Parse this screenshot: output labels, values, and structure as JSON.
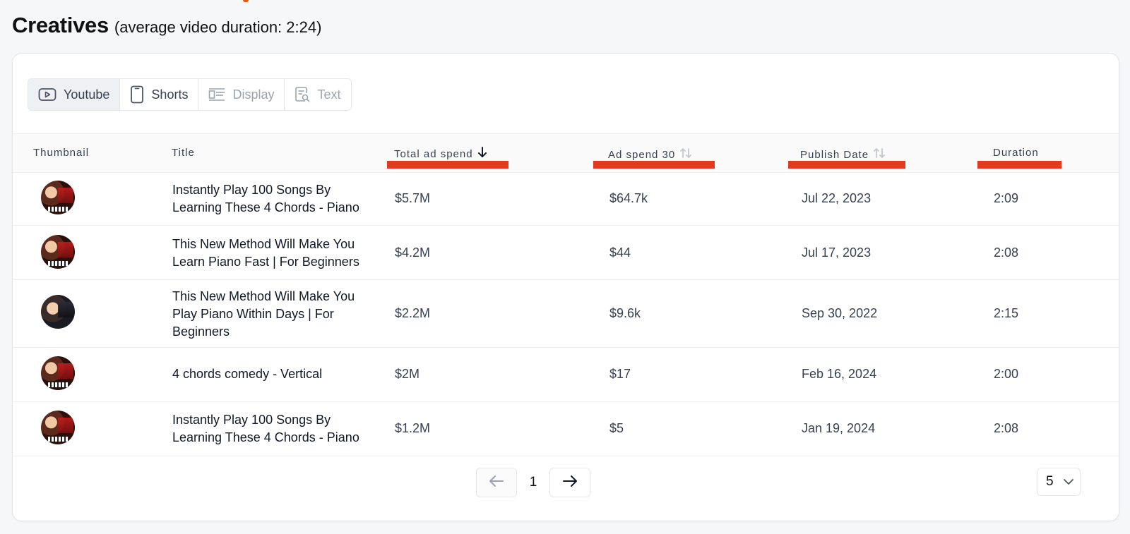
{
  "header": {
    "title": "Creatives",
    "subtitle": "(average video duration: 2:24)"
  },
  "tabs": [
    {
      "label": "Youtube",
      "icon": "youtube-icon",
      "state": "active"
    },
    {
      "label": "Shorts",
      "icon": "shorts-icon",
      "state": "normal"
    },
    {
      "label": "Display",
      "icon": "display-icon",
      "state": "disabled"
    },
    {
      "label": "Text",
      "icon": "text-ad-icon",
      "state": "disabled"
    }
  ],
  "columns": {
    "thumbnail": "Thumbnail",
    "title": "Title",
    "total_ad_spend": "Total ad spend",
    "ad_spend_30": "Ad spend 30",
    "publish_date": "Publish Date",
    "duration": "Duration"
  },
  "highlight_color": "#e5391f",
  "rows": [
    {
      "title_line1": "Instantly Play 100 Songs By",
      "title_line2": "Learning These 4 Chords - Piano",
      "title_line3": "",
      "total": "$5.7M",
      "spend30": "$64.7k",
      "date": "Jul 22, 2023",
      "duration": "2:09"
    },
    {
      "title_line1": "This New Method Will Make You",
      "title_line2": "Learn Piano Fast | For Beginners",
      "title_line3": "",
      "total": "$4.2M",
      "spend30": "$44",
      "date": "Jul 17, 2023",
      "duration": "2:08"
    },
    {
      "title_line1": "This New Method Will Make You",
      "title_line2": "Play Piano Within Days | For",
      "title_line3": "Beginners",
      "total": "$2.2M",
      "spend30": "$9.6k",
      "date": "Sep 30, 2022",
      "duration": "2:15"
    },
    {
      "title_line1": "4 chords comedy - Vertical",
      "title_line2": "",
      "title_line3": "",
      "total": "$2M",
      "spend30": "$17",
      "date": "Feb 16, 2024",
      "duration": "2:00"
    },
    {
      "title_line1": "Instantly Play 100 Songs By",
      "title_line2": "Learning These 4 Chords - Piano",
      "title_line3": "",
      "total": "$1.2M",
      "spend30": "$5",
      "date": "Jan 19, 2024",
      "duration": "2:08"
    }
  ],
  "pagination": {
    "current_page": "1",
    "page_size": "5"
  }
}
